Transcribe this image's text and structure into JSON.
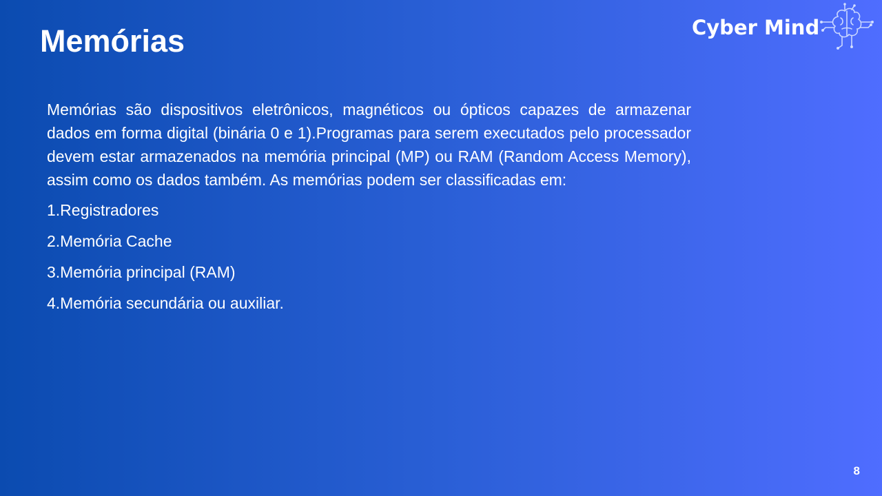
{
  "slide": {
    "title": "Memórias",
    "logo": {
      "text": "Cyber Mind",
      "icon": "brain-circuit-icon"
    },
    "paragraph": "Memórias são dispositivos eletrônicos, magnéticos ou ópticos capazes de armazenar dados em forma digital (binária 0 e 1).Programas para serem executados pelo processador devem estar armazenados na memória principal (MP) ou RAM (Random Access Memory), assim como os dados também. As memórias podem ser classificadas em:",
    "list": [
      "1.Registradores",
      "2.Memória Cache",
      "3.Memória principal (RAM)",
      "4.Memória secundária ou auxiliar."
    ],
    "page_number": "8"
  },
  "colors": {
    "gradient_start": "#0b4bb0",
    "gradient_end": "#4f6dff",
    "text": "#ffffff"
  }
}
